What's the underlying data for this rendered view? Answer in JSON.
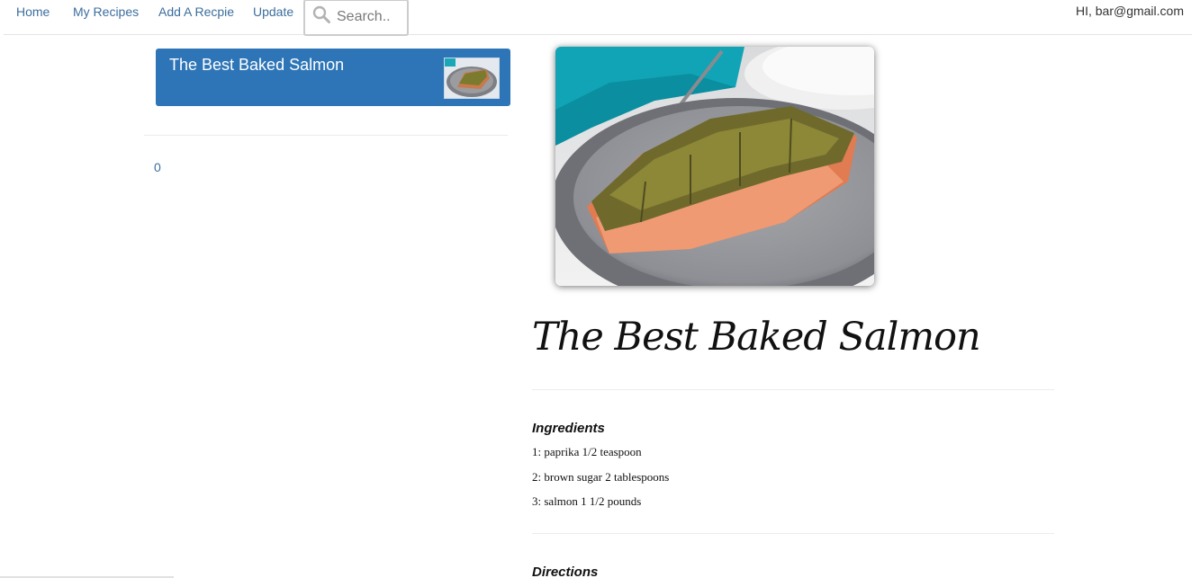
{
  "nav": {
    "items": [
      {
        "label": "Home"
      },
      {
        "label": "My Recipes"
      },
      {
        "label": "Add A Recpie"
      },
      {
        "label": "Update"
      }
    ],
    "search": {
      "placeholder": "Search.."
    },
    "greeting": "HI, bar@gmail.com"
  },
  "sidebar": {
    "card": {
      "title": "The Best Baked Salmon"
    },
    "count": "0"
  },
  "recipe": {
    "title": "The Best Baked Salmon",
    "ingredients_heading": "Ingredients",
    "ingredients": [
      "1: paprika 1/2 teaspoon",
      "2: brown sugar 2 tablespoons",
      "3: salmon 1 1/2 pounds"
    ],
    "directions_heading": "Directions"
  },
  "colors": {
    "link": "#3c6e9e",
    "card_background": "#2e75b8"
  },
  "icons": {
    "search": "search-icon"
  }
}
